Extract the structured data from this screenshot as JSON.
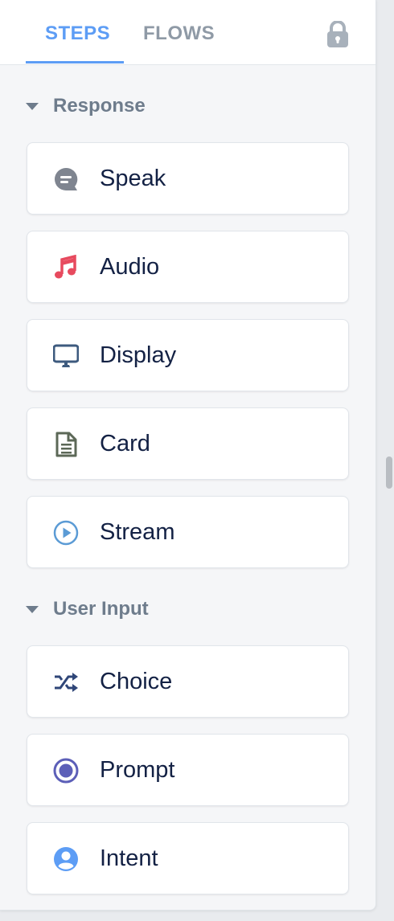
{
  "tabs": {
    "steps_label": "STEPS",
    "flows_label": "FLOWS",
    "active": "STEPS"
  },
  "sections": [
    {
      "title": "Response",
      "items": [
        {
          "label": "Speak",
          "icon": "speech-bubble-icon"
        },
        {
          "label": "Audio",
          "icon": "music-note-icon"
        },
        {
          "label": "Display",
          "icon": "monitor-icon"
        },
        {
          "label": "Card",
          "icon": "document-icon"
        },
        {
          "label": "Stream",
          "icon": "play-circle-icon"
        }
      ]
    },
    {
      "title": "User Input",
      "items": [
        {
          "label": "Choice",
          "icon": "shuffle-icon"
        },
        {
          "label": "Prompt",
          "icon": "radio-dot-icon"
        },
        {
          "label": "Intent",
          "icon": "user-circle-icon"
        }
      ]
    }
  ],
  "colors": {
    "accent": "#5d9df5",
    "inactive_tab": "#8f9aa6",
    "section_header": "#6e7c8c",
    "step_text": "#132144",
    "speak_icon": "#7f8590",
    "audio_icon": "#e74a5e",
    "display_icon": "#3d5a7e",
    "card_icon": "#5c6857",
    "stream_icon": "#5b9bd5",
    "choice_icon": "#2f4678",
    "prompt_icon": "#5c5fb8",
    "intent_icon": "#5d9df5"
  }
}
